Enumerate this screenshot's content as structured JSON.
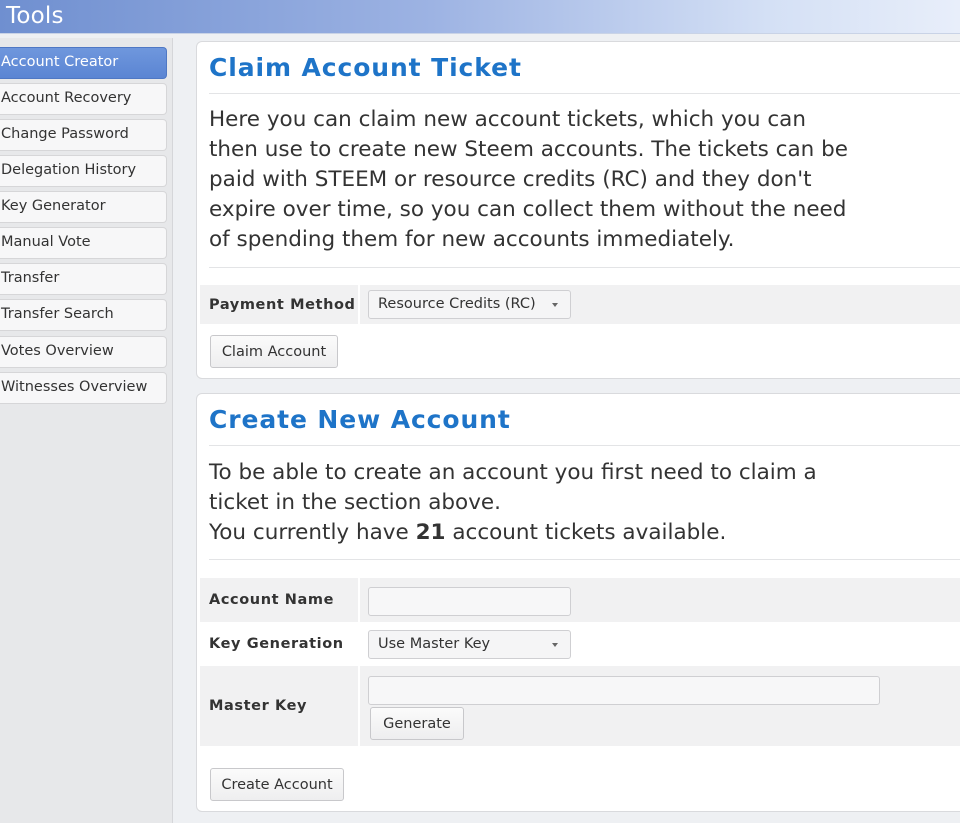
{
  "header": {
    "title": "' Tools"
  },
  "sidebar": {
    "items": [
      {
        "label": "Account Creator",
        "active": true
      },
      {
        "label": "Account Recovery"
      },
      {
        "label": "Change Password"
      },
      {
        "label": "Delegation History"
      },
      {
        "label": "Key Generator"
      },
      {
        "label": "Manual Vote"
      },
      {
        "label": "Transfer"
      },
      {
        "label": "Transfer Search"
      },
      {
        "label": "Votes Overview"
      },
      {
        "label": "Witnesses Overview"
      }
    ]
  },
  "claim": {
    "title": "Claim Account Ticket",
    "description": "Here you can claim new account tickets, which you can then use to create new Steem accounts. The tickets can be paid with STEEM or resource credits (RC) and they don't expire over time, so you can collect them without the need of spending them for new accounts immediately.",
    "payment_method_label": "Payment Method",
    "payment_method_value": "Resource Credits (RC)",
    "claim_button": "Claim Account"
  },
  "create": {
    "title": "Create New Account",
    "description_line1": "To be able to create an account you first need to claim a ticket in the section above.",
    "tickets_prefix": "You currently have ",
    "tickets_count": "21",
    "tickets_suffix": " account tickets available.",
    "account_name_label": "Account Name",
    "account_name_value": "",
    "key_generation_label": "Key Generation",
    "key_generation_value": "Use Master Key",
    "master_key_label": "Master Key",
    "master_key_value": "",
    "generate_button": "Generate",
    "create_button": "Create Account"
  },
  "colors": {
    "accent": "#1e74c8",
    "active_nav": "#5b85d3"
  }
}
